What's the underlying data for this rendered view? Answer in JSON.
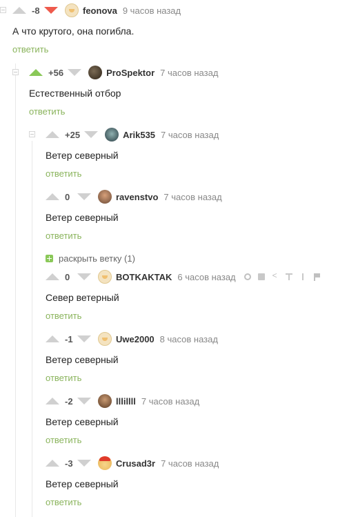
{
  "comments": [
    {
      "rating": "-8",
      "vote": "down",
      "avatar": "default",
      "nick": "feonova",
      "time": "9 часов назад",
      "text": "А что крутого, она погибла.",
      "reply": "ответить"
    },
    {
      "rating": "+56",
      "vote": "up",
      "avatar": "dark",
      "nick": "ProSpektor",
      "time": "7 часов назад",
      "text": "Естественный отбор",
      "reply": "ответить"
    },
    {
      "rating": "+25",
      "vote": "none",
      "avatar": "teal",
      "nick": "Arik535",
      "time": "7 часов назад",
      "text": "Ветер северный",
      "reply": "ответить"
    },
    {
      "rating": "0",
      "vote": "none",
      "avatar": "photo",
      "nick": "ravenstvo",
      "time": "7 часов назад",
      "text": "Ветер северный",
      "reply": "ответить"
    },
    {
      "rating": "0",
      "vote": "none",
      "avatar": "default",
      "nick": "BOTKAKTAK",
      "time": "6 часов назад",
      "text": "Север ветерный",
      "reply": "ответить"
    },
    {
      "rating": "-1",
      "vote": "none",
      "avatar": "default",
      "nick": "Uwe2000",
      "time": "8 часов назад",
      "text": "Ветер северный",
      "reply": "ответить"
    },
    {
      "rating": "-2",
      "vote": "none",
      "avatar": "man",
      "nick": "lllillll",
      "time": "7 часов назад",
      "text": "Ветер северный",
      "reply": "ответить"
    },
    {
      "rating": "-3",
      "vote": "none",
      "avatar": "santa",
      "nick": "Crusad3r",
      "time": "7 часов назад",
      "text": "Ветер северный",
      "reply": "ответить"
    }
  ],
  "expand_branch": {
    "label": "раскрыть ветку (1)"
  },
  "tool_icons": [
    "link-icon",
    "save-icon",
    "share-icon",
    "go-to-top-icon",
    "branch-icon",
    "report-flag-icon"
  ],
  "colors": {
    "upvote": "#8ac858",
    "downvote": "#ee5a4c",
    "reply": "#8ab45c",
    "neutral_arrow": "#d0d0d0"
  }
}
